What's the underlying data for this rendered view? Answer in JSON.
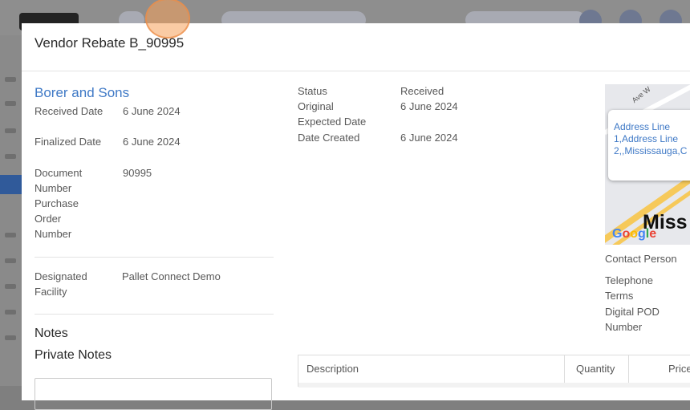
{
  "modal": {
    "title": "Vendor Rebate B_90995"
  },
  "vendor": {
    "name": "Borer and Sons"
  },
  "left_fields": [
    {
      "label": "Received Date",
      "value": "6 June 2024"
    },
    {
      "label": "Finalized Date",
      "value": "6 June 2024"
    },
    {
      "label": "Document Number",
      "value": "90995"
    },
    {
      "label": "Purchase Order Number",
      "value": ""
    }
  ],
  "facility": {
    "label": "Designated Facility",
    "value": "Pallet Connect Demo"
  },
  "notes": {
    "notes_label": "Notes",
    "private_label": "Private Notes"
  },
  "middle_fields": [
    {
      "label": "Status",
      "value": "Received"
    },
    {
      "label": "Original Expected Date",
      "value": "6 June 2024"
    },
    {
      "label": "Date Created",
      "value": "6 June 2024"
    }
  ],
  "map": {
    "address": "Address Line 1,Address Line 2,,Mississauga,C",
    "city": "Miss",
    "street": "Ave W",
    "attribution": "Google"
  },
  "right_fields": {
    "contact_person": "Contact Person",
    "telephone": "Telephone",
    "terms": "Terms",
    "digital_pod": "Digital POD Number"
  },
  "table": {
    "columns": [
      "Description",
      "Quantity",
      "Price"
    ]
  }
}
